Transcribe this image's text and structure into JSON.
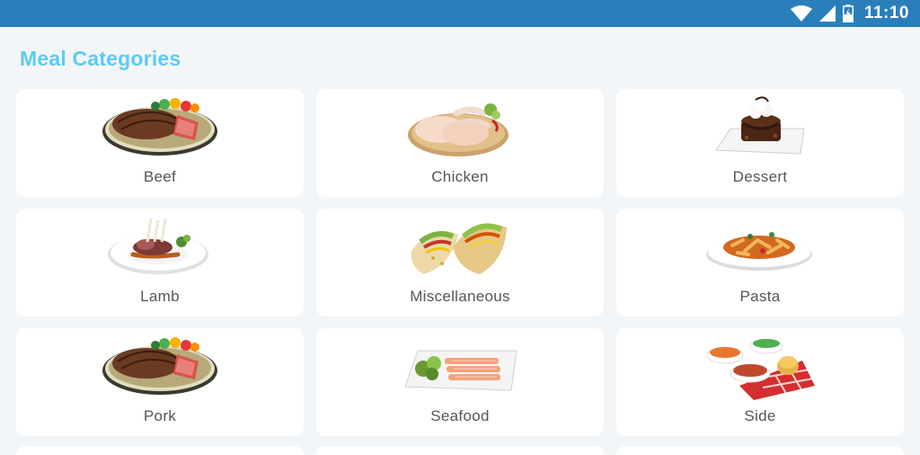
{
  "status_bar": {
    "time": "11:10",
    "icons": [
      "wifi-icon",
      "signal-icon",
      "battery-charging-icon"
    ],
    "background": "#2a7fbb"
  },
  "page": {
    "title": "Meal Categories",
    "title_color": "#5ccbf2"
  },
  "categories": [
    {
      "label": "Beef",
      "image": "steak-plate-image"
    },
    {
      "label": "Chicken",
      "image": "chicken-legs-image"
    },
    {
      "label": "Dessert",
      "image": "chocolate-cake-image"
    },
    {
      "label": "Lamb",
      "image": "lamb-chops-image"
    },
    {
      "label": "Miscellaneous",
      "image": "tacos-image"
    },
    {
      "label": "Pasta",
      "image": "penne-pasta-image"
    },
    {
      "label": "Pork",
      "image": "steak-plate-image"
    },
    {
      "label": "Seafood",
      "image": "salmon-platter-image"
    },
    {
      "label": "Side",
      "image": "side-dishes-image"
    }
  ]
}
